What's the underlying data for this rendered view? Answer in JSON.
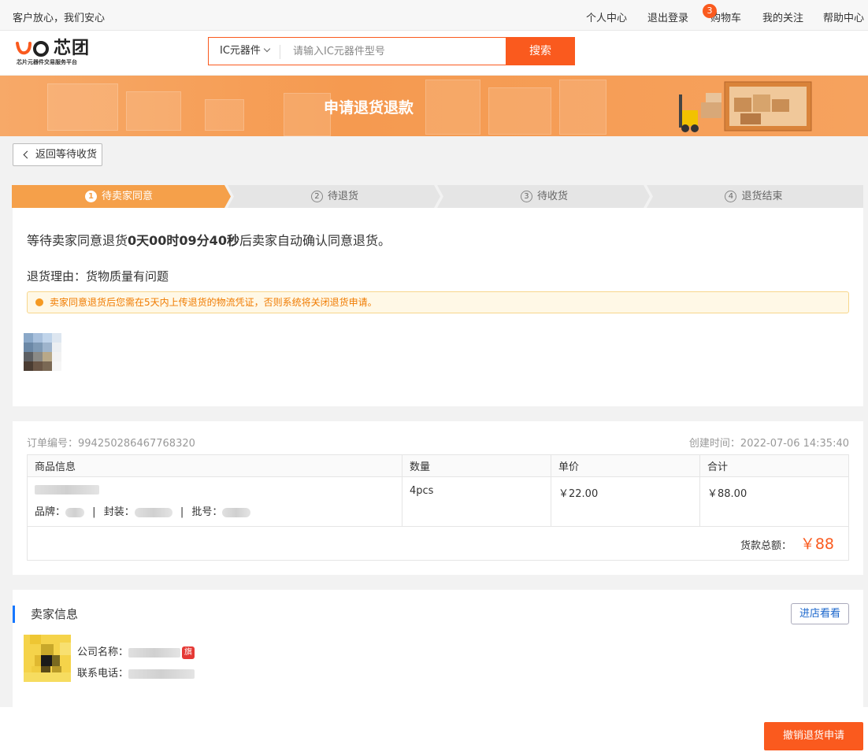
{
  "topbar": {
    "slogan": "客户放心，我们安心",
    "links": [
      "个人中心",
      "退出登录",
      "购物车",
      "我的关注",
      "帮助中心"
    ],
    "cart_count": "3"
  },
  "header": {
    "logo_text": "芯团",
    "logo_sub": "芯片元器件交易服务平台",
    "search_category": "IC元器件",
    "search_placeholder": "请输入IC元器件型号",
    "search_button": "搜索"
  },
  "banner": {
    "title": "申请退货退款"
  },
  "back_button": "返回等待收货",
  "steps": [
    {
      "num": "1",
      "label": "待卖家同意"
    },
    {
      "num": "2",
      "label": "待退货"
    },
    {
      "num": "3",
      "label": "待收货"
    },
    {
      "num": "4",
      "label": "退货结束"
    }
  ],
  "status": {
    "countdown_prefix": "等待卖家同意退货",
    "countdown_value": "0天00时09分40秒",
    "countdown_suffix": "后卖家自动确认同意退货。",
    "reason": "退货理由：货物质量有问题",
    "notice": "卖家同意退货后您需在5天内上传退货的物流凭证，否则系统将关闭退货申请。"
  },
  "order": {
    "order_no": "订单编号：994250286467768320",
    "created": "创建时间：2022-07-06 14:35:40",
    "headers": [
      "商品信息",
      "数量",
      "单价",
      "合计"
    ],
    "brand_label": "品牌：",
    "package_label": "封装：",
    "batch_label": "批号：",
    "sep": "|",
    "quantity": "4pcs",
    "unit_price": "￥22.00",
    "subtotal": "￥88.00",
    "total_label": "货款总额：",
    "total": "￥88"
  },
  "seller": {
    "title": "卖家信息",
    "shop_button": "进店看看",
    "company_label": "公司名称：",
    "flag": "旗",
    "phone_label": "联系电话："
  },
  "cancel_button": "撤销退货申请",
  "colors": {
    "accent": "#fa5a1e",
    "step_active": "#f5a04a",
    "info_blue": "#1677ff"
  }
}
